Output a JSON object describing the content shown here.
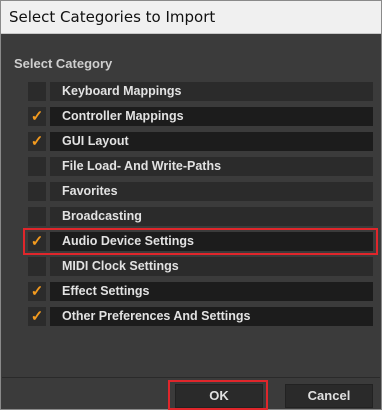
{
  "window": {
    "title": "Select Categories to Import"
  },
  "heading": "Select Category",
  "categories": [
    {
      "label": "Keyboard Mappings",
      "checked": false
    },
    {
      "label": "Controller Mappings",
      "checked": true
    },
    {
      "label": "GUI Layout",
      "checked": true
    },
    {
      "label": "File Load- And Write-Paths",
      "checked": false
    },
    {
      "label": "Favorites",
      "checked": false
    },
    {
      "label": "Broadcasting",
      "checked": false
    },
    {
      "label": "Audio Device Settings",
      "checked": true,
      "highlighted": true
    },
    {
      "label": "MIDI Clock Settings",
      "checked": false
    },
    {
      "label": "Effect Settings",
      "checked": true
    },
    {
      "label": "Other Preferences And Settings",
      "checked": true
    }
  ],
  "checkmark": "✓",
  "buttons": {
    "ok": "OK",
    "cancel": "Cancel"
  },
  "colors": {
    "check": "#f29a1f",
    "highlight": "#e0262b"
  }
}
